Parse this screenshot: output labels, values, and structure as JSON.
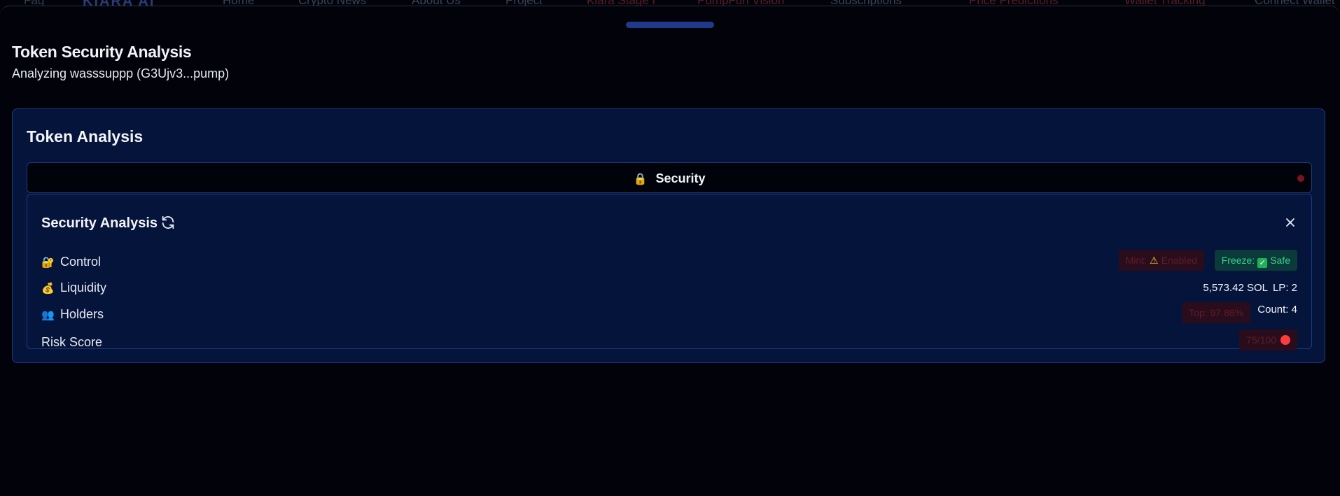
{
  "background_nav": {
    "items": [
      "Faq",
      "KIARA AI",
      "Home",
      "Crypto News",
      "About Us",
      "Project",
      "Kiara Stage I",
      "PumpFun Vision",
      "Subscriptions",
      "Price Predictions",
      "Wallet Tracking",
      "Connect Wallet"
    ]
  },
  "header": {
    "title": "Token Security Analysis",
    "subtitle": "Analyzing wasssuppp (G3Ujv3...pump)"
  },
  "card": {
    "title": "Token Analysis",
    "tab": {
      "label": "Security",
      "icon": "lock-icon"
    }
  },
  "security": {
    "title": "Security Analysis",
    "rows": {
      "control": {
        "label": "Control",
        "icon": "lock-key-icon",
        "mint_label": "Mint:",
        "mint_value": "Enabled",
        "freeze_label": "Freeze:",
        "freeze_value": "Safe"
      },
      "liquidity": {
        "label": "Liquidity",
        "icon": "money-bag-icon",
        "amount": "5,573.42 SOL",
        "lp": "LP: 2"
      },
      "holders": {
        "label": "Holders",
        "icon": "users-icon",
        "top": "Top: 97.86%",
        "count": "Count: 4"
      },
      "risk": {
        "label": "Risk Score",
        "score": "75/100"
      }
    }
  },
  "colors": {
    "accent": "#1f3a8a",
    "danger": "#ff3b3b",
    "safe": "#3bd38a",
    "card_bg": "#05143a"
  }
}
